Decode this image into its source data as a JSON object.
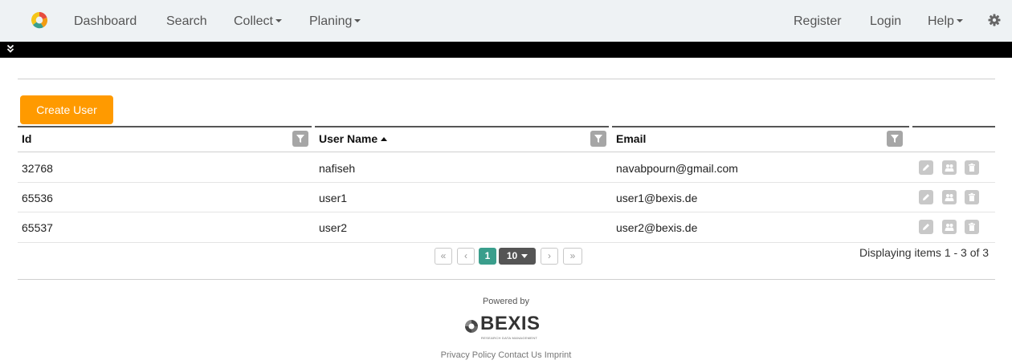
{
  "nav": {
    "logo_icon": "bexis-logo-icon",
    "left": [
      {
        "label": "Dashboard",
        "dropdown": false
      },
      {
        "label": "Search",
        "dropdown": false
      },
      {
        "label": "Collect",
        "dropdown": true
      },
      {
        "label": "Planing",
        "dropdown": true
      }
    ],
    "right": [
      {
        "label": "Register",
        "dropdown": false
      },
      {
        "label": "Login",
        "dropdown": false
      },
      {
        "label": "Help",
        "dropdown": true
      }
    ],
    "settings_icon": "gear-icon"
  },
  "toggle_icon": "double-chevron-down-icon",
  "create_button": "Create User",
  "table": {
    "columns": [
      "Id",
      "User Name",
      "Email"
    ],
    "sorted_column": "User Name",
    "sort_direction": "ascending",
    "rows": [
      {
        "id": "32768",
        "username": "nafiseh",
        "email": "navabpourn@gmail.com"
      },
      {
        "id": "65536",
        "username": "user1",
        "email": "user1@bexis.de"
      },
      {
        "id": "65537",
        "username": "user2",
        "email": "user2@bexis.de"
      }
    ],
    "row_actions": [
      "edit-icon",
      "users-icon",
      "trash-icon"
    ]
  },
  "pager": {
    "first": "«",
    "prev": "‹",
    "current_page": "1",
    "page_size": "10",
    "next": "›",
    "last": "»",
    "info": "Displaying items 1 - 3 of 3"
  },
  "footer": {
    "powered_by": "Powered by",
    "brand": "BEXIS",
    "brand_tagline": "RESEARCH DATA MANAGEMENT",
    "links": [
      "Privacy Policy",
      "Contact Us",
      "Imprint"
    ]
  },
  "colors": {
    "nav_bg": "#eef2f4",
    "accent_orange": "#ff9a00",
    "pager_current": "#3a9e8c",
    "bar_black": "#000000"
  }
}
